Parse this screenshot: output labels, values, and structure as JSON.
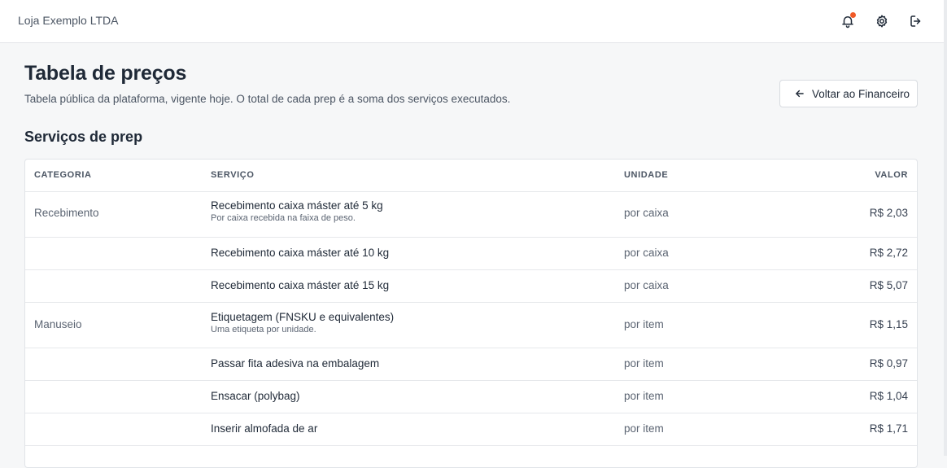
{
  "header": {
    "brand": "Loja Exemplo LTDA",
    "icons": [
      "bell-icon",
      "gear-icon",
      "logout-icon"
    ],
    "notification_color": "#f05a28"
  },
  "page": {
    "title": "Tabela de preços",
    "subtitle": "Tabela pública da plataforma, vigente hoje. O total de cada prep é a soma dos serviços executados.",
    "back_button": "Voltar ao Financeiro"
  },
  "section": {
    "title": "Serviços de prep"
  },
  "table": {
    "columns": [
      "CATEGORIA",
      "SERVIÇO",
      "UNIDADE",
      "VALOR"
    ],
    "rows": [
      {
        "category": "Recebimento",
        "service": "Recebimento caixa máster até 5 kg",
        "note": "Por caixa recebida na faixa de peso.",
        "unit": "por caixa",
        "value": "R$ 2,03"
      },
      {
        "category": "",
        "service": "Recebimento caixa máster até 10 kg",
        "note": "",
        "unit": "por caixa",
        "value": "R$ 2,72"
      },
      {
        "category": "",
        "service": "Recebimento caixa máster até 15 kg",
        "note": "",
        "unit": "por caixa",
        "value": "R$ 5,07"
      },
      {
        "category": "Manuseio",
        "service": "Etiquetagem (FNSKU e equivalentes)",
        "note": "Uma etiqueta por unidade.",
        "unit": "por item",
        "value": "R$ 1,15"
      },
      {
        "category": "",
        "service": "Passar fita adesiva na embalagem",
        "note": "",
        "unit": "por item",
        "value": "R$ 0,97"
      },
      {
        "category": "",
        "service": "Ensacar (polybag)",
        "note": "",
        "unit": "por item",
        "value": "R$ 1,04"
      },
      {
        "category": "",
        "service": "Inserir almofada de ar",
        "note": "",
        "unit": "por item",
        "value": "R$ 1,71"
      }
    ]
  }
}
